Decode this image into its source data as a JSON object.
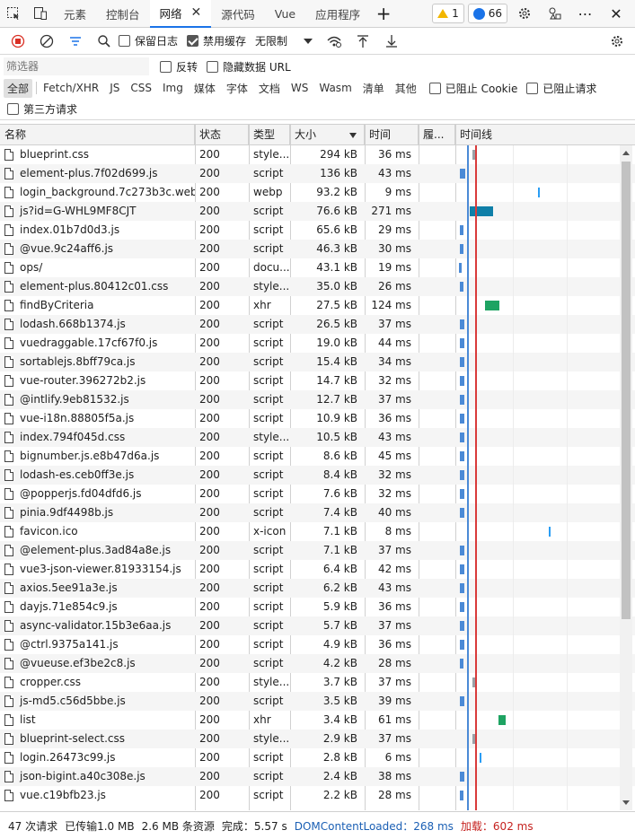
{
  "tabs": [
    {
      "label": "元素"
    },
    {
      "label": "控制台"
    },
    {
      "label": "网络",
      "active": true
    },
    {
      "label": "源代码"
    },
    {
      "label": "Vue"
    },
    {
      "label": "应用程序"
    }
  ],
  "badges": {
    "warnings": "1",
    "issues": "66"
  },
  "toolbar": {
    "preserve_log": "保留日志",
    "disable_cache": "禁用缓存",
    "throttle": "无限制"
  },
  "filter": {
    "placeholder": "筛选器",
    "invert": "反转",
    "hide_data_urls": "隐藏数据 URL",
    "types": [
      "全部",
      "Fetch/XHR",
      "JS",
      "CSS",
      "Img",
      "媒体",
      "字体",
      "文档",
      "WS",
      "Wasm",
      "清单",
      "其他"
    ],
    "blocked_cookies": "已阻止 Cookie",
    "blocked_requests": "已阻止请求",
    "third_party": "第三方请求"
  },
  "columns": {
    "name": "名称",
    "status": "状态",
    "type": "类型",
    "size": "大小",
    "time": "时间",
    "priority": "履...",
    "waterfall": "时间线"
  },
  "rows": [
    {
      "name": "blueprint.css",
      "status": "200",
      "type": "style...",
      "size": "294 kB",
      "time": "36 ms",
      "bar_color": "#9aa0a6",
      "bar_start_ms": 50,
      "bar_ms": 30
    },
    {
      "name": "element-plus.7f02d699.js",
      "status": "200",
      "type": "script",
      "size": "136 kB",
      "time": "43 ms",
      "bar_color": "#4b8ad6",
      "bar_start_ms": 5,
      "bar_ms": 40
    },
    {
      "name": "login_background.7c273b3c.webp",
      "status": "200",
      "type": "webp",
      "size": "93.2 kB",
      "time": "9 ms",
      "bar_color": "#2a9df4",
      "bar_start_ms": 300,
      "bar_ms": 15
    },
    {
      "name": "js?id=G-WHL9MF8CJT",
      "status": "200",
      "type": "script",
      "size": "76.6 kB",
      "time": "271 ms",
      "bar_color": "#0f7fa8",
      "bar_start_ms": 40,
      "bar_ms": 180
    },
    {
      "name": "index.01b7d0d3.js",
      "status": "200",
      "type": "script",
      "size": "65.6 kB",
      "time": "29 ms",
      "bar_color": "#4b8ad6",
      "bar_start_ms": 5,
      "bar_ms": 25
    },
    {
      "name": "@vue.9c24aff6.js",
      "status": "200",
      "type": "script",
      "size": "46.3 kB",
      "time": "30 ms",
      "bar_color": "#4b8ad6",
      "bar_start_ms": 5,
      "bar_ms": 25
    },
    {
      "name": "ops/",
      "status": "200",
      "type": "docu...",
      "size": "43.1 kB",
      "time": "19 ms",
      "bar_color": "#4b8ad6",
      "bar_start_ms": 0,
      "bar_ms": 18
    },
    {
      "name": "element-plus.80412c01.css",
      "status": "200",
      "type": "style...",
      "size": "35.0 kB",
      "time": "26 ms",
      "bar_color": "#4b8ad6",
      "bar_start_ms": 5,
      "bar_ms": 25
    },
    {
      "name": "findByCriteria",
      "status": "200",
      "type": "xhr",
      "size": "27.5 kB",
      "time": "124 ms",
      "bar_color": "#1ea362",
      "bar_start_ms": 100,
      "bar_ms": 110
    },
    {
      "name": "lodash.668b1374.js",
      "status": "200",
      "type": "script",
      "size": "26.5 kB",
      "time": "37 ms",
      "bar_color": "#4b8ad6",
      "bar_start_ms": 5,
      "bar_ms": 30
    },
    {
      "name": "vuedraggable.17cf67f0.js",
      "status": "200",
      "type": "script",
      "size": "19.0 kB",
      "time": "44 ms",
      "bar_color": "#4b8ad6",
      "bar_start_ms": 5,
      "bar_ms": 30
    },
    {
      "name": "sortablejs.8bff79ca.js",
      "status": "200",
      "type": "script",
      "size": "15.4 kB",
      "time": "34 ms",
      "bar_color": "#4b8ad6",
      "bar_start_ms": 5,
      "bar_ms": 30
    },
    {
      "name": "vue-router.396272b2.js",
      "status": "200",
      "type": "script",
      "size": "14.7 kB",
      "time": "32 ms",
      "bar_color": "#4b8ad6",
      "bar_start_ms": 5,
      "bar_ms": 30
    },
    {
      "name": "@intlify.9eb81532.js",
      "status": "200",
      "type": "script",
      "size": "12.7 kB",
      "time": "37 ms",
      "bar_color": "#4b8ad6",
      "bar_start_ms": 5,
      "bar_ms": 30
    },
    {
      "name": "vue-i18n.88805f5a.js",
      "status": "200",
      "type": "script",
      "size": "10.9 kB",
      "time": "36 ms",
      "bar_color": "#4b8ad6",
      "bar_start_ms": 5,
      "bar_ms": 30
    },
    {
      "name": "index.794f045d.css",
      "status": "200",
      "type": "style...",
      "size": "10.5 kB",
      "time": "43 ms",
      "bar_color": "#4b8ad6",
      "bar_start_ms": 5,
      "bar_ms": 30
    },
    {
      "name": "bignumber.js.e8b47d6a.js",
      "status": "200",
      "type": "script",
      "size": "8.6 kB",
      "time": "45 ms",
      "bar_color": "#4b8ad6",
      "bar_start_ms": 5,
      "bar_ms": 30
    },
    {
      "name": "lodash-es.ceb0ff3e.js",
      "status": "200",
      "type": "script",
      "size": "8.4 kB",
      "time": "32 ms",
      "bar_color": "#4b8ad6",
      "bar_start_ms": 5,
      "bar_ms": 30
    },
    {
      "name": "@popperjs.fd04dfd6.js",
      "status": "200",
      "type": "script",
      "size": "7.6 kB",
      "time": "32 ms",
      "bar_color": "#4b8ad6",
      "bar_start_ms": 5,
      "bar_ms": 30
    },
    {
      "name": "pinia.9df4498b.js",
      "status": "200",
      "type": "script",
      "size": "7.4 kB",
      "time": "40 ms",
      "bar_color": "#4b8ad6",
      "bar_start_ms": 5,
      "bar_ms": 30
    },
    {
      "name": "favicon.ico",
      "status": "200",
      "type": "x-icon",
      "size": "7.1 kB",
      "time": "8 ms",
      "bar_color": "#2a9df4",
      "bar_start_ms": 340,
      "bar_ms": 10
    },
    {
      "name": "@element-plus.3ad84a8e.js",
      "status": "200",
      "type": "script",
      "size": "7.1 kB",
      "time": "37 ms",
      "bar_color": "#4b8ad6",
      "bar_start_ms": 5,
      "bar_ms": 30
    },
    {
      "name": "vue3-json-viewer.81933154.js",
      "status": "200",
      "type": "script",
      "size": "6.4 kB",
      "time": "42 ms",
      "bar_color": "#4b8ad6",
      "bar_start_ms": 5,
      "bar_ms": 30
    },
    {
      "name": "axios.5ee91a3e.js",
      "status": "200",
      "type": "script",
      "size": "6.2 kB",
      "time": "43 ms",
      "bar_color": "#4b8ad6",
      "bar_start_ms": 5,
      "bar_ms": 30
    },
    {
      "name": "dayjs.71e854c9.js",
      "status": "200",
      "type": "script",
      "size": "5.9 kB",
      "time": "36 ms",
      "bar_color": "#4b8ad6",
      "bar_start_ms": 5,
      "bar_ms": 30
    },
    {
      "name": "async-validator.15b3e6aa.js",
      "status": "200",
      "type": "script",
      "size": "5.7 kB",
      "time": "37 ms",
      "bar_color": "#4b8ad6",
      "bar_start_ms": 5,
      "bar_ms": 30
    },
    {
      "name": "@ctrl.9375a141.js",
      "status": "200",
      "type": "script",
      "size": "4.9 kB",
      "time": "36 ms",
      "bar_color": "#4b8ad6",
      "bar_start_ms": 5,
      "bar_ms": 30
    },
    {
      "name": "@vueuse.ef3be2c8.js",
      "status": "200",
      "type": "script",
      "size": "4.2 kB",
      "time": "28 ms",
      "bar_color": "#4b8ad6",
      "bar_start_ms": 5,
      "bar_ms": 25
    },
    {
      "name": "cropper.css",
      "status": "200",
      "type": "style...",
      "size": "3.7 kB",
      "time": "37 ms",
      "bar_color": "#9aa0a6",
      "bar_start_ms": 50,
      "bar_ms": 30
    },
    {
      "name": "js-md5.c56d5bbe.js",
      "status": "200",
      "type": "script",
      "size": "3.5 kB",
      "time": "39 ms",
      "bar_color": "#4b8ad6",
      "bar_start_ms": 5,
      "bar_ms": 30
    },
    {
      "name": "list",
      "status": "200",
      "type": "xhr",
      "size": "3.4 kB",
      "time": "61 ms",
      "bar_color": "#1ea362",
      "bar_start_ms": 150,
      "bar_ms": 55
    },
    {
      "name": "blueprint-select.css",
      "status": "200",
      "type": "style...",
      "size": "2.9 kB",
      "time": "37 ms",
      "bar_color": "#9aa0a6",
      "bar_start_ms": 50,
      "bar_ms": 30
    },
    {
      "name": "login.26473c99.js",
      "status": "200",
      "type": "script",
      "size": "2.8 kB",
      "time": "6 ms",
      "bar_color": "#2a9df4",
      "bar_start_ms": 80,
      "bar_ms": 10
    },
    {
      "name": "json-bigint.a40c308e.js",
      "status": "200",
      "type": "script",
      "size": "2.4 kB",
      "time": "38 ms",
      "bar_color": "#4b8ad6",
      "bar_start_ms": 5,
      "bar_ms": 30
    },
    {
      "name": "vue.c19bfb23.js",
      "status": "200",
      "type": "script",
      "size": "2.2 kB",
      "time": "28 ms",
      "bar_color": "#4b8ad6",
      "bar_start_ms": 5,
      "bar_ms": 25
    }
  ],
  "waterfall": {
    "total_ms": 5570,
    "dcl_ms": 268,
    "load_ms": 602
  },
  "status": {
    "requests": "47 次请求",
    "transferred": "已传输1.0 MB",
    "resources": "2.6 MB 条资源",
    "finish": "完成：5.57 s",
    "dcl": "DOMContentLoaded：268 ms",
    "load": "加载：602 ms"
  }
}
